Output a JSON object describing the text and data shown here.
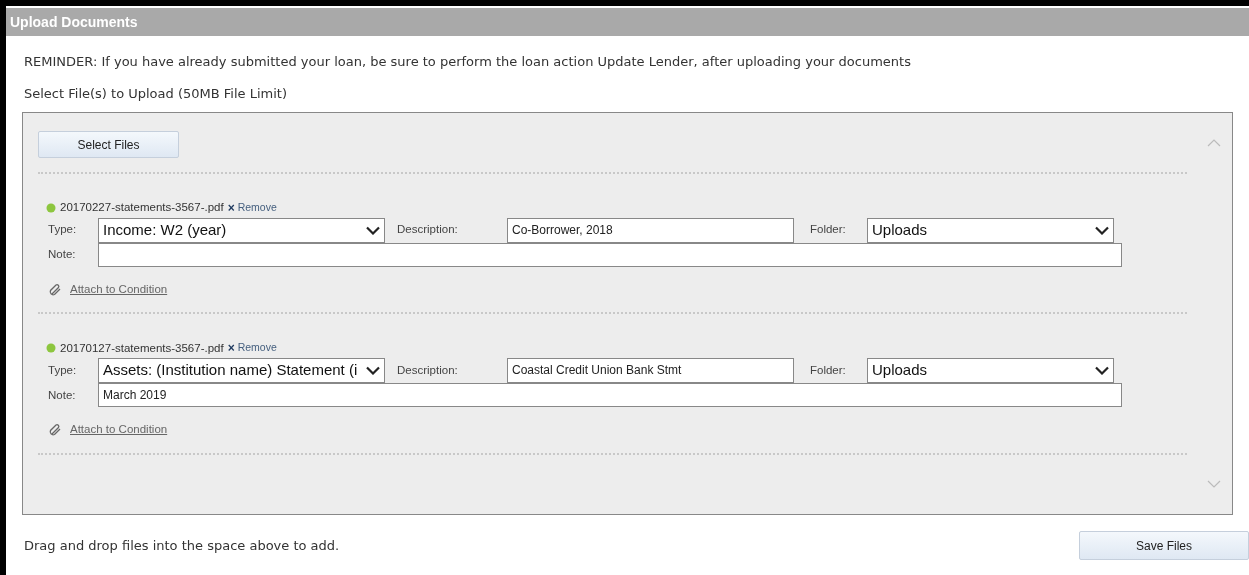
{
  "window": {
    "title": "Upload Documents"
  },
  "reminder": "REMINDER: If you have already submitted your loan, be sure to perform the loan action Update Lender, after uploading your documents",
  "select_label": "Select File(s) to Upload (50MB File Limit)",
  "select_button": "Select Files",
  "files": [
    {
      "name": "20170227-statements-3567-.pdf",
      "remove_glyph": "×",
      "remove": "Remove",
      "labels": {
        "type": "Type:",
        "description": "Description:",
        "folder": "Folder:",
        "note": "Note:"
      },
      "type": "Income: W2 (year)",
      "description": "Co-Borrower, 2018",
      "folder": "Uploads",
      "attach": "Attach to Condition"
    },
    {
      "name": "20170127-statements-3567-.pdf",
      "remove_glyph": "×",
      "remove": "Remove",
      "labels": {
        "type": "Type:",
        "description": "Description:",
        "folder": "Folder:",
        "note": "Note:"
      },
      "type": "Assets: (Institution name) Statement (i",
      "description": "Coastal Credit Union Bank Stmt",
      "folder": "Uploads",
      "note": "March 2019",
      "attach": "Attach to Condition"
    }
  ],
  "hint": "Drag and drop files into the space above to add.",
  "save_button": "Save Files"
}
